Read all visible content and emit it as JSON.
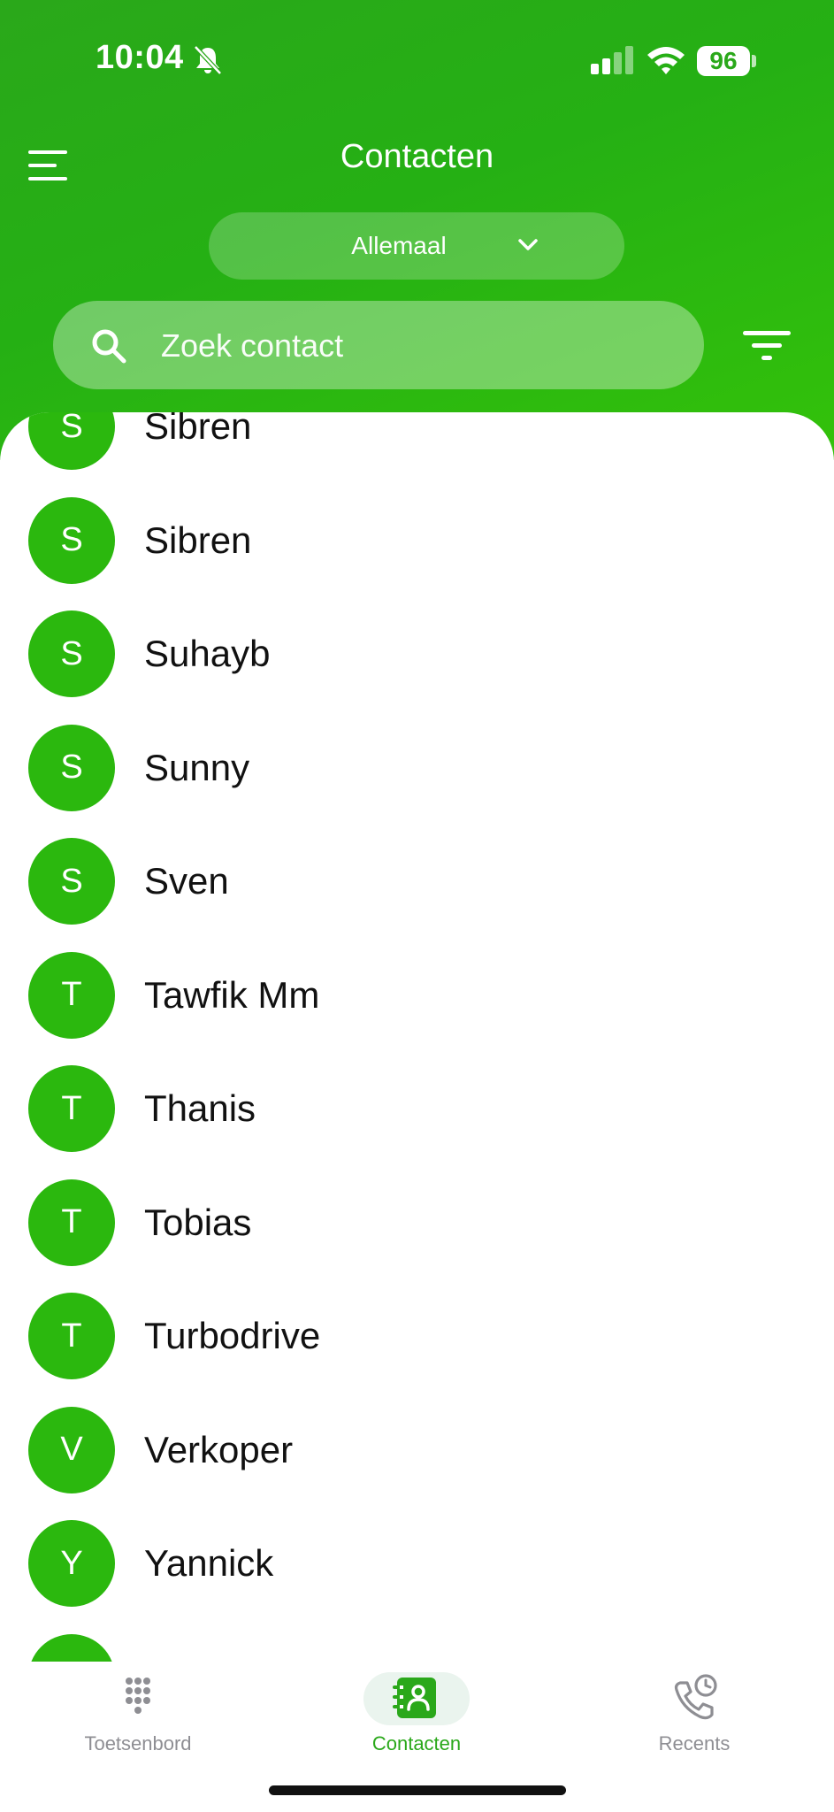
{
  "status_bar": {
    "time": "10:04",
    "battery": "96"
  },
  "header": {
    "title": "Contacten",
    "scope_label": "Allemaal",
    "search_placeholder": "Zoek contact"
  },
  "contacts": [
    {
      "initial": "S",
      "name": "Sibren"
    },
    {
      "initial": "S",
      "name": "Sibren"
    },
    {
      "initial": "S",
      "name": "Suhayb"
    },
    {
      "initial": "S",
      "name": "Sunny"
    },
    {
      "initial": "S",
      "name": "Sven"
    },
    {
      "initial": "T",
      "name": "Tawfik Mm"
    },
    {
      "initial": "T",
      "name": "Thanis"
    },
    {
      "initial": "T",
      "name": "Tobias"
    },
    {
      "initial": "T",
      "name": "Turbodrive"
    },
    {
      "initial": "V",
      "name": "Verkoper"
    },
    {
      "initial": "Y",
      "name": "Yannick"
    },
    {
      "initial": "",
      "name": ""
    }
  ],
  "tabs": [
    {
      "label": "Toetsenbord",
      "icon": "dialpad-icon",
      "active": false
    },
    {
      "label": "Contacten",
      "icon": "contacts-book-icon",
      "active": true
    },
    {
      "label": "Recents",
      "icon": "phone-clock-icon",
      "active": false
    }
  ],
  "colors": {
    "brand_green": "#2aa81a",
    "avatar_green": "#2bb80e"
  }
}
